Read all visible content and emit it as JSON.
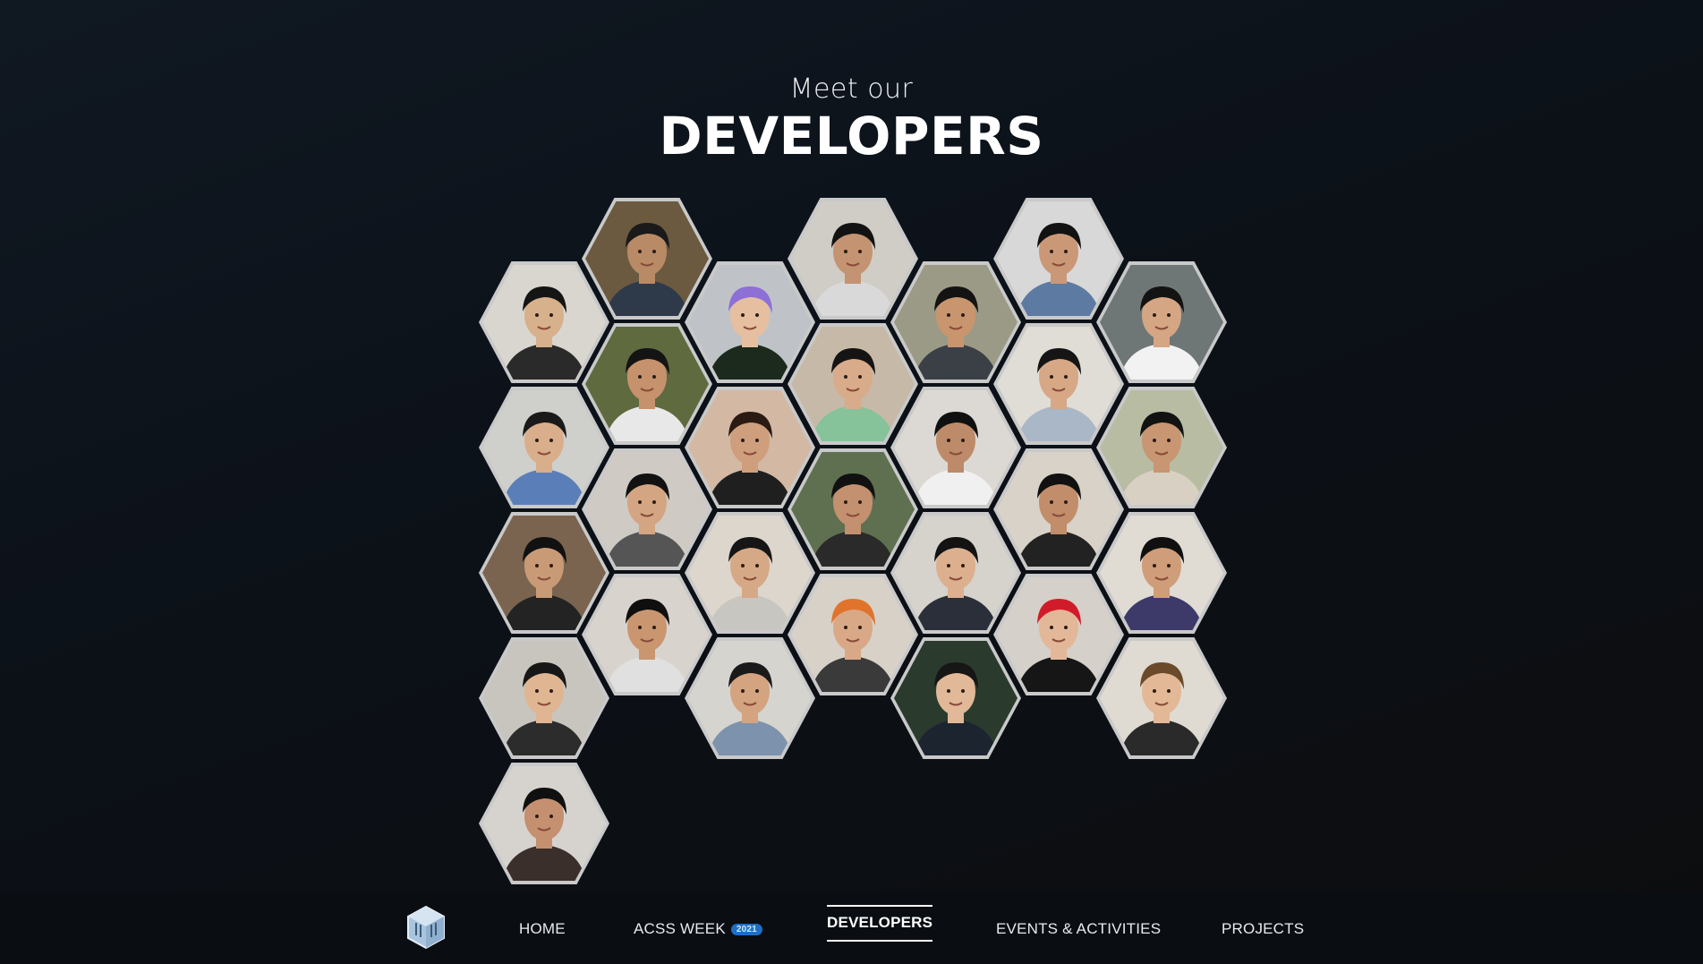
{
  "heading": {
    "subtitle": "Meet our",
    "title": "DEVELOPERS"
  },
  "developers": [
    {
      "skin": "#d7b08c",
      "hair": "#151515",
      "shirt": "#2a2a2a",
      "bg": "#d9d6d0"
    },
    {
      "skin": "#d9ae8a",
      "hair": "#1a1a1a",
      "shirt": "#5a7fb8",
      "bg": "#cfd0cc"
    },
    {
      "skin": "#c99a76",
      "hair": "#111111",
      "shirt": "#232323",
      "bg": "#7a6450"
    },
    {
      "skin": "#e0b592",
      "hair": "#171717",
      "shirt": "#2c2c2c",
      "bg": "#c8c4be"
    },
    {
      "skin": "#c49070",
      "hair": "#101010",
      "shirt": "#3a2f2a",
      "bg": "#d6d3cf"
    },
    {
      "skin": "#b98a66",
      "hair": "#1a1a1a",
      "shirt": "#2e3a4a",
      "bg": "#6b5a40"
    },
    {
      "skin": "#c6926d",
      "hair": "#141414",
      "shirt": "#e8e8e8",
      "bg": "#5f6a3f"
    },
    {
      "skin": "#d3a583",
      "hair": "#121212",
      "shirt": "#555555",
      "bg": "#cfcac3"
    },
    {
      "skin": "#c99670",
      "hair": "#0f0f0f",
      "shirt": "#e0e0e0",
      "bg": "#d8d4cd"
    },
    {
      "skin": "#e6bfa0",
      "hair": "#8d6fd6",
      "shirt": "#1b2a1d",
      "bg": "#bfc3c8"
    },
    {
      "skin": "#cf9e7c",
      "hair": "#2a1a12",
      "shirt": "#1f1f1f",
      "bg": "#d3b8a4"
    },
    {
      "skin": "#d6a986",
      "hair": "#161616",
      "shirt": "#c8c6c1",
      "bg": "#ddd6cc"
    },
    {
      "skin": "#d4a37f",
      "hair": "#1a1a1a",
      "shirt": "#7c92ad",
      "bg": "#d6d4cf"
    },
    {
      "skin": "#c49371",
      "hair": "#121212",
      "shirt": "#d9d9d9",
      "bg": "#d0ccc6"
    },
    {
      "skin": "#d8ab8a",
      "hair": "#141414",
      "shirt": "#86c39a",
      "bg": "#c7b9a7"
    },
    {
      "skin": "#c39070",
      "hair": "#111111",
      "shirt": "#2a2a2a",
      "bg": "#5f7050"
    },
    {
      "skin": "#d9a987",
      "hair": "#e0742d",
      "shirt": "#3a3a3a",
      "bg": "#d7d1c8"
    },
    {
      "skin": "#c8956f",
      "hair": "#131313",
      "shirt": "#3b3f46",
      "bg": "#9a9a86"
    },
    {
      "skin": "#bd8b69",
      "hair": "#101010",
      "shirt": "#f0f0f0",
      "bg": "#dcd9d4"
    },
    {
      "skin": "#dcb08f",
      "hair": "#131313",
      "shirt": "#2a2f3a",
      "bg": "#d6d2cc"
    },
    {
      "skin": "#e1b898",
      "hair": "#161616",
      "shirt": "#1c2430",
      "bg": "#2a3b2e"
    },
    {
      "skin": "#cb9877",
      "hair": "#121212",
      "shirt": "#5d7aa3",
      "bg": "#d8d8d8"
    },
    {
      "skin": "#d6a886",
      "hair": "#151515",
      "shirt": "#aab7c6",
      "bg": "#e0ddd6"
    },
    {
      "skin": "#c18d6b",
      "hair": "#111111",
      "shirt": "#222222",
      "bg": "#d9d2c8"
    },
    {
      "skin": "#e2b899",
      "hair": "#d21b2a",
      "shirt": "#161616",
      "bg": "#d5d0c9"
    },
    {
      "skin": "#d5a684",
      "hair": "#131313",
      "shirt": "#f2f2f2",
      "bg": "#6f7676"
    },
    {
      "skin": "#c89672",
      "hair": "#121212",
      "shirt": "#d8d0c2",
      "bg": "#b7bca3"
    },
    {
      "skin": "#cf9d79",
      "hair": "#101010",
      "shirt": "#3d3a6a",
      "bg": "#e0dcd4"
    },
    {
      "skin": "#e3b896",
      "hair": "#6a4a2a",
      "shirt": "#2a2a2a",
      "bg": "#e0dbd2"
    }
  ],
  "nav": {
    "logo_icon": "acss-cube-icon",
    "home": "HOME",
    "acss_week": "ACSS WEEK",
    "acss_week_badge": "2021",
    "developers": "DEVELOPERS",
    "events": "EVENTS & ACTIVITIES",
    "projects": "PROJECTS",
    "active_item": "DEVELOPERS",
    "badge_color": "#1d6fc4"
  }
}
